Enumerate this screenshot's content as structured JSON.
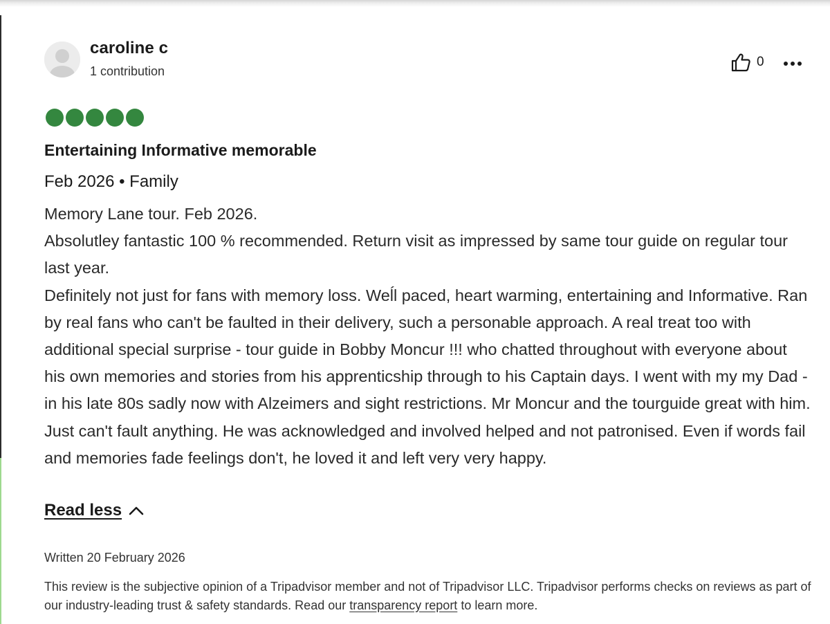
{
  "reviewer": {
    "name": "caroline c",
    "contributions": "1 contribution"
  },
  "actions": {
    "helpful_count": "0",
    "helpful_icon": "thumbs-up-icon",
    "more_icon": "more-options-icon"
  },
  "review": {
    "rating": 5,
    "rating_max": 5,
    "rating_color": "#34873f",
    "title": "Entertaining Informative memorable",
    "trip_meta": "Feb 2026 • Family",
    "body": [
      "Memory Lane tour. Feb 2026.",
      "Absolutley fantastic 100 % recommended. Return visit as impressed by same tour guide on regular tour last year.",
      "Definitely not just for fans with memory loss. Weĺl paced, heart warming, entertaining and Informative. Ran by real fans who can't be faulted in their delivery, such a personable approach. A real treat too with additional special surprise - tour guide in Bobby Moncur !!! who chatted throughout with everyone about his own memories and stories from his apprenticship through to his Captain days. I went with my my Dad - in his late 80s sadly now with Alzeimers and sight restrictions. Mr Moncur and the tourguide great with him. Just can't fault anything. He was acknowledged and involved helped and not patronised. Even if words fail and memories fade feelings don't, he loved it and left very very happy."
    ],
    "read_less_label": "Read less",
    "written_date": "Written 20 February 2026"
  },
  "disclaimer": {
    "text_before": "This review is the subjective opinion of a Tripadvisor member and not of Tripadvisor LLC. Tripadvisor performs checks on reviews as part of our industry-leading trust & safety standards. Read our ",
    "link_label": "transparency report",
    "text_after": " to learn more."
  }
}
